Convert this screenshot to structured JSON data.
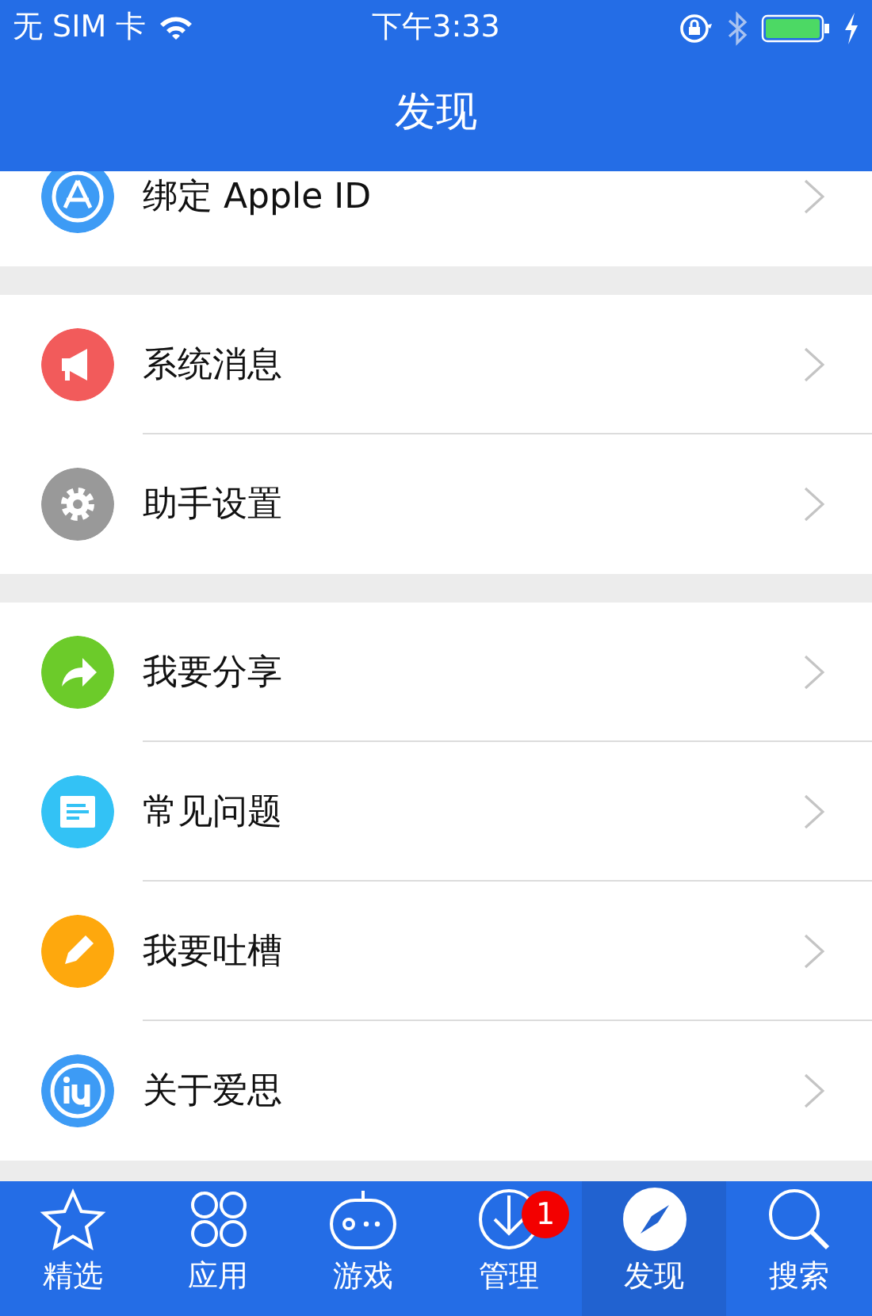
{
  "status_bar": {
    "carrier": "无 SIM 卡",
    "time": "下午3:33"
  },
  "nav_bar": {
    "title": "发现"
  },
  "sections": [
    {
      "items": [
        {
          "label": "绑定 Apple ID",
          "color": "#3d9bf5"
        }
      ]
    },
    {
      "items": [
        {
          "label": "系统消息",
          "color": "#f25b5b"
        },
        {
          "label": "助手设置",
          "color": "#999999"
        }
      ]
    },
    {
      "items": [
        {
          "label": "我要分享",
          "color": "#6ccb2a"
        },
        {
          "label": "常见问题",
          "color": "#33c2f5"
        },
        {
          "label": "我要吐槽",
          "color": "#fea80d"
        },
        {
          "label": "关于爱思",
          "color": "#3d9bf5"
        }
      ]
    }
  ],
  "tab_bar": [
    {
      "label": "精选",
      "selected": false
    },
    {
      "label": "应用",
      "selected": false
    },
    {
      "label": "游戏",
      "selected": false
    },
    {
      "label": "管理",
      "selected": false,
      "badge": "1"
    },
    {
      "label": "发现",
      "selected": true
    },
    {
      "label": "搜索",
      "selected": false
    }
  ]
}
